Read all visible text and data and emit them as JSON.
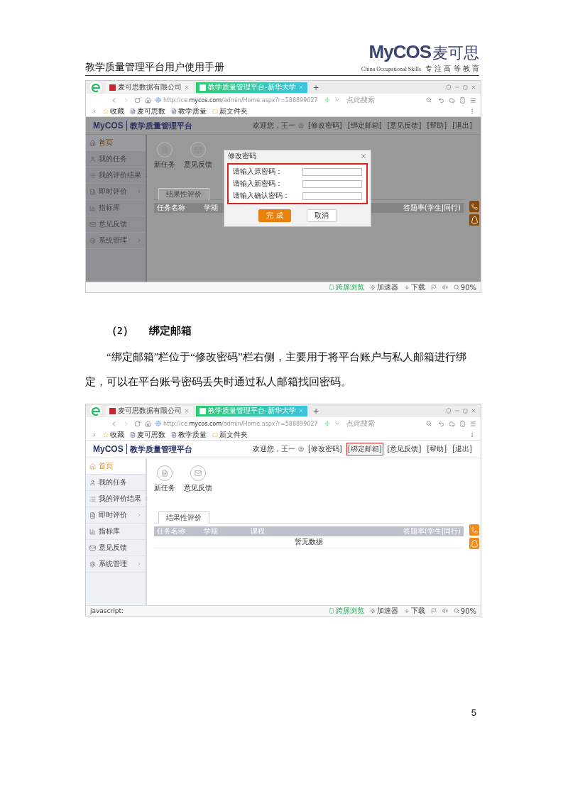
{
  "header": {
    "title": "教学质量管理平台用户使用手册",
    "logo": {
      "brand": "MyCOS",
      "brand_cn": "麦可思",
      "tagline_en": "China Occupational Skills",
      "tagline_cn": "专 注 高 等 教 育"
    }
  },
  "screenshot_1": {
    "browser": {
      "tabs": [
        {
          "label": "麦可思数据有限公司",
          "selected": false
        },
        {
          "label": "教学质量管理平台-新华大学",
          "selected": true
        }
      ],
      "new_tab": "+",
      "url": "http://ce.**mycos.com**/admin/Home.aspx?r=588899027",
      "search_placeholder": "点此搜索",
      "bookmarks": [
        "收藏",
        "麦可思数",
        "教学质量",
        "新文件夹"
      ],
      "status_items": [
        "跨屏浏览",
        "加速器",
        "下载"
      ],
      "zoom": "90%"
    },
    "app": {
      "dimmed": true,
      "logo": "MyCOS",
      "title": "教学质量管理平台",
      "greeting": "欢迎您，王一",
      "nav": [
        {
          "label": "[修改密码]",
          "highlighted": false
        },
        {
          "label": "[绑定邮箱]",
          "highlighted": false
        },
        {
          "label": "[意见反馈]",
          "highlighted": false
        },
        {
          "label": "[帮助]",
          "highlighted": false
        },
        {
          "label": "[退出]",
          "highlighted": false
        }
      ],
      "sidebar": [
        {
          "label": "首页",
          "selected": true,
          "submenu": false
        },
        {
          "label": "我的任务",
          "selected": false,
          "submenu": false
        },
        {
          "label": "我的评价结果",
          "selected": false,
          "submenu": true
        },
        {
          "label": "即时评价",
          "selected": false,
          "submenu": true
        },
        {
          "label": "指标库",
          "selected": false,
          "submenu": false
        },
        {
          "label": "意见反馈",
          "selected": false,
          "submenu": false
        },
        {
          "label": "系统管理",
          "selected": false,
          "submenu": true
        }
      ],
      "tiles": [
        "新任务",
        "意见反馈"
      ],
      "tabs": [
        {
          "label": "结果性评价",
          "selected": true
        }
      ],
      "columns": [
        "任务名称",
        "学期",
        "答题率(学生|同行)"
      ],
      "dialog": {
        "title": "修改密码",
        "highlighted": true,
        "fields": [
          "请输入原密码：",
          "请输入新密码：",
          "请输入确认密码："
        ],
        "buttons": [
          {
            "label": "完 成",
            "kind": "primary"
          },
          {
            "label": "取消",
            "kind": "secondary"
          }
        ]
      }
    }
  },
  "section": {
    "number": "（2）",
    "title": "绑定邮箱",
    "paragraph": "“绑定邮箱”栏位于“修改密码”栏右侧，主要用于将平台账户与私人邮箱进行绑定，可以在平台账号密码丢失时通过私人邮箱找回密码。"
  },
  "screenshot_2": {
    "browser": {
      "tabs": [
        {
          "label": "麦可思数据有限公司",
          "selected": false
        },
        {
          "label": "教学质量管理平台-新华大学",
          "selected": true
        }
      ],
      "new_tab": "+",
      "url": "http://ce.**mycos.com**/admin/Home.aspx?r=588899027",
      "search_placeholder": "点此搜索",
      "bookmarks": [
        "收藏",
        "麦可思数",
        "教学质量",
        "新文件夹"
      ],
      "status_text": "javascript:",
      "status_items": [
        "跨屏浏览",
        "加速器",
        "下载"
      ],
      "zoom": "90%"
    },
    "app": {
      "dimmed": false,
      "logo": "MyCOS",
      "title": "教学质量管理平台",
      "greeting": "欢迎您，王一",
      "nav": [
        {
          "label": "[修改密码]",
          "highlighted": false
        },
        {
          "label": "[绑定邮箱]",
          "highlighted": true
        },
        {
          "label": "[意见反馈]",
          "highlighted": false
        },
        {
          "label": "[帮助]",
          "highlighted": false
        },
        {
          "label": "[退出]",
          "highlighted": false
        }
      ],
      "sidebar": [
        {
          "label": "首页",
          "selected": true,
          "submenu": false
        },
        {
          "label": "我的任务",
          "selected": false,
          "submenu": false
        },
        {
          "label": "我的评价结果",
          "selected": false,
          "submenu": true
        },
        {
          "label": "即时评价",
          "selected": false,
          "submenu": true
        },
        {
          "label": "指标库",
          "selected": false,
          "submenu": false
        },
        {
          "label": "意见反馈",
          "selected": false,
          "submenu": false
        },
        {
          "label": "系统管理",
          "selected": false,
          "submenu": true
        }
      ],
      "tiles": [
        "新任务",
        "意见反馈"
      ],
      "tabs": [
        {
          "label": "结果性评价",
          "selected": true
        }
      ],
      "columns": [
        "任务名称",
        "学期",
        "课程",
        "答题率(学生|同行)"
      ],
      "empty_text": "暂无数据"
    }
  },
  "page_number": "5"
}
